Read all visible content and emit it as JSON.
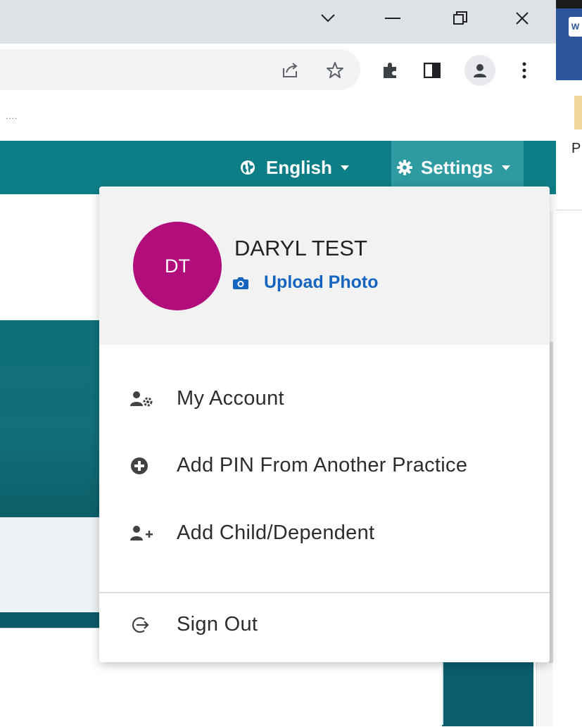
{
  "browser": {
    "sidebar_app_letter": "W",
    "sidebar_peek_text": "P",
    "bookmarks_overflow": "...."
  },
  "navbar": {
    "language_label": "English",
    "settings_label": "Settings"
  },
  "menu": {
    "avatar_initials": "DT",
    "user_name": "DARYL TEST",
    "upload_photo_label": "Upload Photo",
    "items": [
      {
        "label": "My Account",
        "icon": "user-gear-icon"
      },
      {
        "label": "Add PIN From Another Practice",
        "icon": "plus-circle-icon"
      },
      {
        "label": "Add Child/Dependent",
        "icon": "user-plus-icon"
      }
    ],
    "sign_out_label": "Sign Out"
  },
  "colors": {
    "navbar": "#0e7e86",
    "avatar": "#b10e7c",
    "link": "#1565c0"
  }
}
